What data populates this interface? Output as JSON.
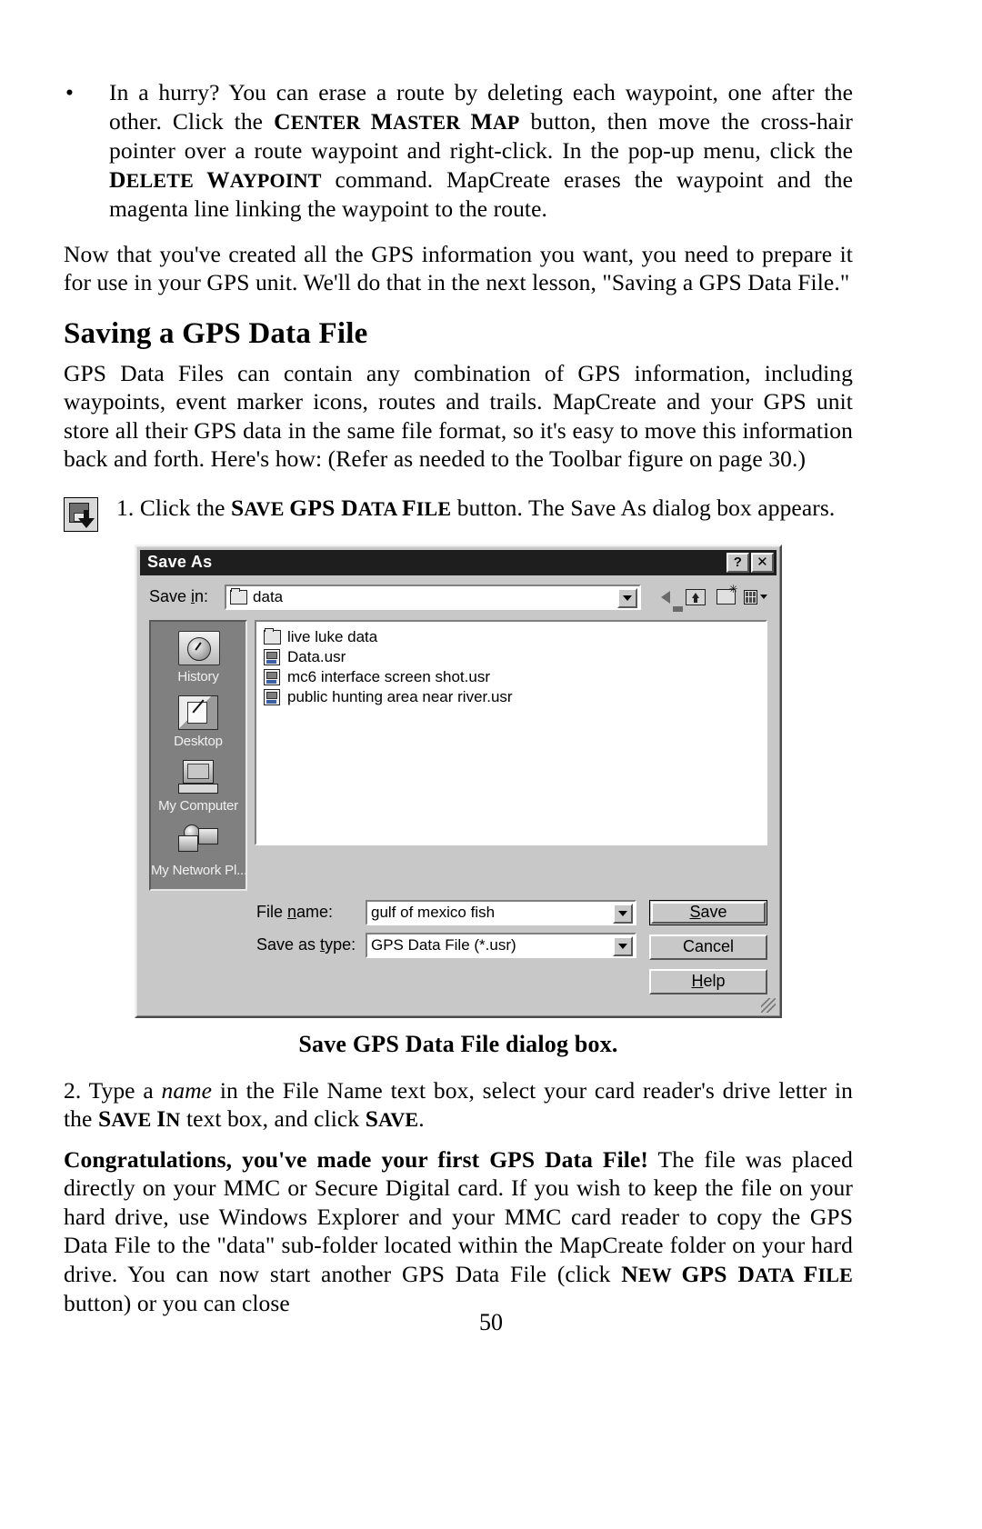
{
  "page": {
    "number": "50"
  },
  "bullet": {
    "marker": "•",
    "seg1": "In a hurry? You can erase a route by deleting each waypoint, one after the other. Click the ",
    "sc1_cap": "C",
    "sc1_rest": "ENTER ",
    "sc1b_cap": "M",
    "sc1b_rest": "ASTER ",
    "sc1c_cap": "M",
    "sc1c_rest": "AP",
    "seg2": " button, then move the cross-hair pointer over a route waypoint and right-click. In the pop-up menu, click the ",
    "sc2_cap": "D",
    "sc2_rest": "ELETE ",
    "sc2b_cap": "W",
    "sc2b_rest": "AYPOINT",
    "seg3": " command. MapCreate erases the waypoint and the magenta line linking the waypoint to the route."
  },
  "intro_paragraph": "Now that you've created all the GPS information you want, you need to prepare it for use in your GPS unit. We'll do that in the next lesson, \"Saving a GPS Data File.\"",
  "section_heading": "Saving a GPS Data File",
  "section_paragraph": "GPS Data Files can contain any combination of GPS information, including waypoints, event marker icons, routes and trails. MapCreate and your GPS unit store all their GPS data in the same file format, so it's easy to move this information back and forth. Here's how: (Refer as needed to the Toolbar figure on page 30.)",
  "step1": {
    "number": "1. ",
    "seg1": "Click the ",
    "sc_cap": "S",
    "sc_rest": "AVE ",
    "sc_b_cap": "GPS ",
    "sc_c_cap": "D",
    "sc_c_rest": "ATA ",
    "sc_d_cap": "F",
    "sc_d_rest": "ILE",
    "seg2": " button. The Save As dialog box appears.",
    "icon": "save-gps-data-file-toolbar-icon"
  },
  "dialog": {
    "title": "Save As",
    "help_button": "?",
    "close_button": "✕",
    "save_in_label_pre": "Save ",
    "save_in_label_u": "i",
    "save_in_label_post": "n:",
    "save_in_value": "data",
    "nav_icons": [
      "back-arrow-icon",
      "up-one-level-icon",
      "new-folder-icon",
      "view-menu-icon"
    ],
    "places": [
      {
        "label": "History",
        "icon": "history-icon"
      },
      {
        "label": "Desktop",
        "icon": "desktop-icon"
      },
      {
        "label": "My Computer",
        "icon": "my-computer-icon"
      },
      {
        "label": "My Network Pl...",
        "icon": "my-network-places-icon"
      }
    ],
    "files": [
      {
        "name": "live luke data",
        "icon": "folder-icon",
        "type": "folder"
      },
      {
        "name": "Data.usr",
        "icon": "usr-file-icon",
        "type": "file"
      },
      {
        "name": "mc6 interface screen shot.usr",
        "icon": "usr-file-icon",
        "type": "file"
      },
      {
        "name": "public hunting area near river.usr",
        "icon": "usr-file-icon",
        "type": "file"
      }
    ],
    "file_name_label_pre": "File ",
    "file_name_label_u": "n",
    "file_name_label_post": "ame:",
    "file_name_value": "gulf of mexico fish",
    "save_as_type_label_pre": "Save as ",
    "save_as_type_label_u": "t",
    "save_as_type_label_post": "ype:",
    "save_as_type_value": "GPS Data File (*.usr)",
    "buttons": {
      "save": "Save",
      "save_u": "S",
      "save_rest": "ave",
      "cancel": "Cancel",
      "help": "Help",
      "help_u": "H",
      "help_pre": "",
      "help_rest": "elp"
    }
  },
  "figure_caption": "Save GPS Data File dialog box.",
  "step2": {
    "seg1": "2. Type a ",
    "italic": "name",
    "seg2": " in the File Name text box, select your card reader's drive letter in the ",
    "sc_cap": "S",
    "sc_rest": "AVE ",
    "sc_b_cap": "I",
    "sc_b_rest": "N",
    "seg3": " text box, and click ",
    "sc_c_cap": "S",
    "sc_c_rest": "AVE",
    "seg4": "."
  },
  "final_paragraph": {
    "bold_lead": "Congratulations, you've made your first GPS Data File!",
    "seg1": " The file was placed directly on your MMC or Secure Digital card. If you wish to keep the file on your hard drive, use Windows Explorer and your MMC card reader to copy the GPS Data File to the \"data\" sub-folder located within the MapCreate folder on your hard drive. You can now start another GPS Data File (click ",
    "sc_cap": "N",
    "sc_rest": "EW ",
    "sc_b_cap": "GPS ",
    "sc_c_cap": "D",
    "sc_c_rest": "ATA ",
    "sc_d_cap": "F",
    "sc_d_rest": "ILE",
    "seg2": " button) or you can close"
  }
}
